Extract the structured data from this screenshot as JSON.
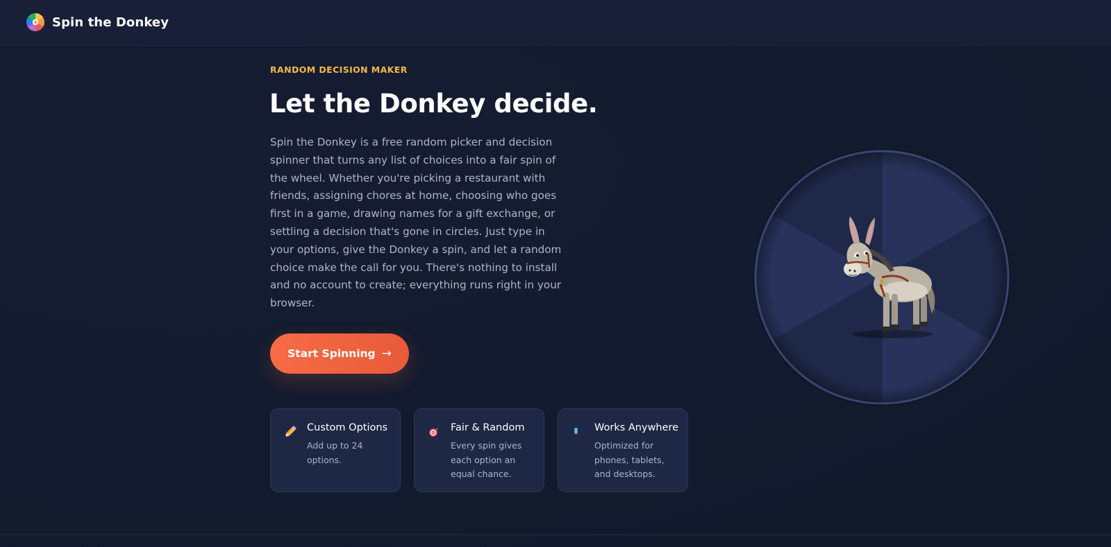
{
  "header": {
    "brand_name": "Spin the Donkey",
    "logo_icon": "color-wheel-icon"
  },
  "hero": {
    "eyebrow": "RANDOM DECISION MAKER",
    "title": "Let the Donkey decide.",
    "description": "Spin the Donkey is a free random picker and decision spinner that turns any list of choices into a fair spin of the wheel. Whether you're picking a restaurant with friends, assigning chores at home, choosing who goes first in a game, drawing names for a gift exchange, or settling a decision that's gone in circles. Just type in your options, give the Donkey a spin, and let a random choice make the call for you. There's nothing to install and no account to create; everything runs right in your browser.",
    "cta_label": "Start Spinning",
    "cta_arrow": "→"
  },
  "features": [
    {
      "icon": "pencil-icon",
      "title": "Custom Options",
      "description": "Add up to 24 options."
    },
    {
      "icon": "target-icon",
      "title": "Fair & Random",
      "description": "Every spin gives each option an equal chance."
    },
    {
      "icon": "phone-icon",
      "title": "Works Anywhere",
      "description": "Optimized for phones, tablets, and desktops."
    }
  ],
  "wheel": {
    "center_icon": "donkey-icon"
  },
  "colors": {
    "background": "#131a2e",
    "navbar": "#181f37",
    "accent": "#f5b942",
    "cta": "#f76c47",
    "card": "#1e2744",
    "wheel_light": "#28325a",
    "wheel_dark": "#1f2848"
  }
}
